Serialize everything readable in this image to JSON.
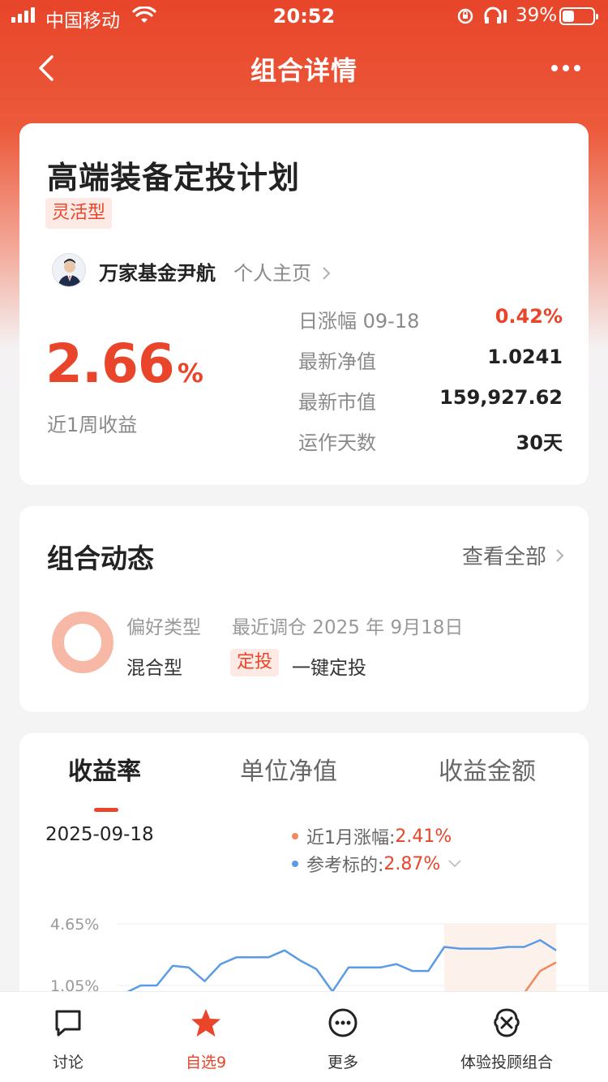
{
  "status_bar": {
    "carrier": "中国移动",
    "time": "20:52",
    "battery": "39%"
  },
  "nav": {
    "title": "组合详情"
  },
  "plan": {
    "name": "高端装备定投计划",
    "tag": "灵活型",
    "manager": "万家基金尹航",
    "homepage_link": "个人主页",
    "weekly_return_value": "2.66",
    "weekly_return_unit": "%",
    "weekly_return_label": "近1周收益",
    "stats": [
      {
        "label": "日涨幅 09-18",
        "value": "0.42%",
        "color": "red"
      },
      {
        "label": "最新净值",
        "value": "1.0241",
        "color": "normal"
      },
      {
        "label": "最新市值",
        "value": "159,927.62",
        "color": "normal"
      },
      {
        "label": "运作天数",
        "value": "30天",
        "color": "normal"
      }
    ]
  },
  "dynamics": {
    "title": "组合动态",
    "view_all": "查看全部",
    "pref_label": "偏好类型",
    "pref_value": "混合型",
    "recent_adjust": "最近调仓 2025 年 9月18日",
    "dt_tag": "定投",
    "action": "一键定投"
  },
  "performance": {
    "tabs": [
      "收益率",
      "单位净值",
      "收益金额"
    ],
    "active_tab": 0,
    "date": "2025-09-18",
    "legend": [
      {
        "label": "近1月涨幅:",
        "value": "2.41%",
        "color": "#f08a5d"
      },
      {
        "label": "参考标的:",
        "value": "2.87%",
        "color": "#5b9be6"
      }
    ]
  },
  "chart_data": {
    "type": "line",
    "y_tick_labels": [
      "4.65%",
      "1.05%"
    ],
    "series": [
      {
        "name": "参考标的",
        "color": "#5b9be6",
        "values": [
          0.6,
          1.05,
          1.05,
          2.2,
          2.1,
          1.3,
          2.3,
          2.7,
          2.7,
          2.7,
          3.1,
          2.5,
          2.0,
          0.7,
          2.1,
          2.1,
          2.1,
          2.3,
          1.9,
          1.9,
          3.3,
          3.2,
          3.2,
          3.2,
          3.3,
          3.3,
          3.7,
          3.1
        ]
      },
      {
        "name": "近1月涨幅",
        "color": "#f08a5d",
        "values": [
          null,
          null,
          null,
          null,
          null,
          null,
          null,
          null,
          null,
          null,
          null,
          null,
          null,
          null,
          null,
          null,
          null,
          null,
          null,
          null,
          null,
          null,
          null,
          null,
          null,
          0.6,
          1.9,
          2.4
        ]
      }
    ],
    "ylim_visible": [
      0.9,
      4.65
    ],
    "grid": true
  },
  "tabbar": {
    "items": [
      {
        "label": "讨论",
        "icon": "chat-bubble-icon",
        "active": false
      },
      {
        "label": "自选9",
        "icon": "star-icon",
        "active": true
      },
      {
        "label": "更多",
        "icon": "more-circle-icon",
        "active": false
      },
      {
        "label": "体验投顾组合",
        "icon": "brain-icon",
        "active": false
      }
    ]
  }
}
